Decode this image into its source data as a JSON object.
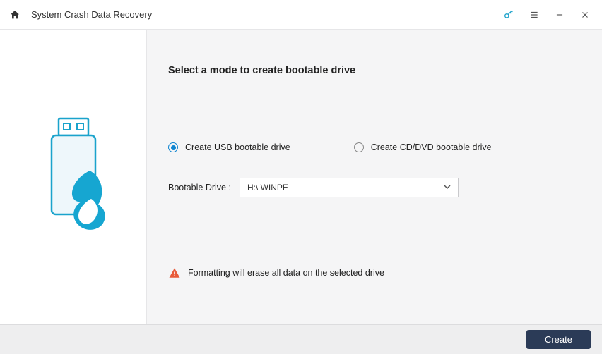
{
  "titlebar": {
    "home_icon": "home-icon",
    "title": "System Crash Data Recovery",
    "key_icon": "key-icon",
    "menu_icon": "menu-icon",
    "minimize_icon": "minimize-icon",
    "close_icon": "close-icon"
  },
  "main": {
    "heading": "Select a mode to create bootable drive",
    "options": {
      "usb": {
        "label": "Create USB bootable drive",
        "selected": true
      },
      "cd": {
        "label": "Create CD/DVD bootable drive",
        "selected": false
      }
    },
    "drive_label": "Bootable Drive :",
    "drive_selected": "H:\\ WINPE",
    "warning": "Formatting will erase all data on the selected drive"
  },
  "footer": {
    "create_label": "Create"
  },
  "colors": {
    "accent": "#18a0c9",
    "radio": "#0f85d1",
    "button_bg": "#2b3b57",
    "warn": "#e85b3a"
  }
}
